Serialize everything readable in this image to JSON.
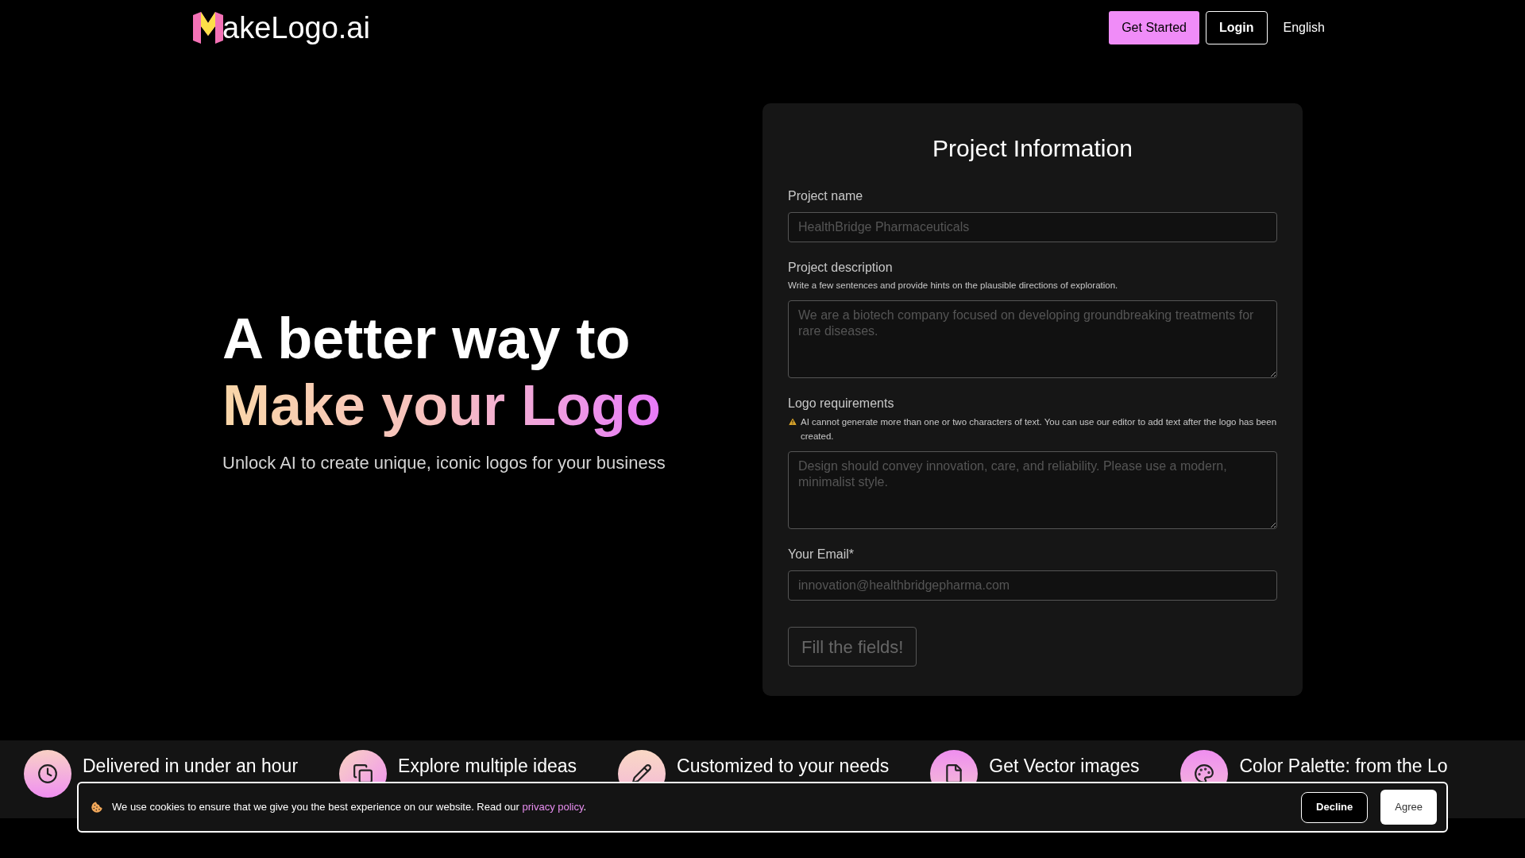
{
  "header": {
    "logo_text": "akeLogo.ai",
    "buttons": [
      {
        "label": "Get Started",
        "kind": "primary"
      },
      {
        "label": "Login",
        "kind": "outline"
      },
      {
        "label": "English",
        "kind": "text"
      }
    ]
  },
  "hero": {
    "title_line": "A better way to",
    "title_gradient": "Make your Logo",
    "subtitle": "Unlock AI to create unique, iconic logos for your business"
  },
  "form": {
    "title": "Project Information",
    "fields": [
      {
        "kind": "input",
        "label": "Project name",
        "placeholder": "HealthBridge Pharmaceuticals"
      },
      {
        "kind": "textarea",
        "label": "Project description",
        "hint": "Write a few sentences and provide hints on the plausible directions of exploration.",
        "placeholder": "We are a biotech company focused on developing groundbreaking treatments for rare diseases."
      },
      {
        "kind": "textarea",
        "label": "Logo requirements",
        "warning": "AI cannot generate more than one or two characters of text. You can use our editor to add text after the logo has been created.",
        "placeholder": "Design should convey innovation, care, and reliability. Please use a modern, minimalist style."
      },
      {
        "kind": "input",
        "label": "Your Email*",
        "placeholder": "innovation@healthbridgepharma.com"
      }
    ],
    "submit": {
      "label": "Fill the fields!",
      "disabled": true
    }
  },
  "features": [
    {
      "kind": "clock",
      "label": "Delivered in under an hour"
    },
    {
      "kind": "copy",
      "label": "Explore multiple ideas"
    },
    {
      "kind": "pencil",
      "label": "Customized to your needs"
    },
    {
      "kind": "file",
      "label": "Get Vector images"
    },
    {
      "kind": "palette",
      "label": "Color Palette: from the Lo"
    }
  ],
  "cookie": {
    "text": "We use cookies to ensure that we give you the best experience on our website. Read our ",
    "link": "privacy policy",
    "after": ".",
    "buttons": [
      {
        "label": "Decline",
        "kind": "dark"
      },
      {
        "label": "Agree",
        "kind": "light"
      }
    ]
  }
}
